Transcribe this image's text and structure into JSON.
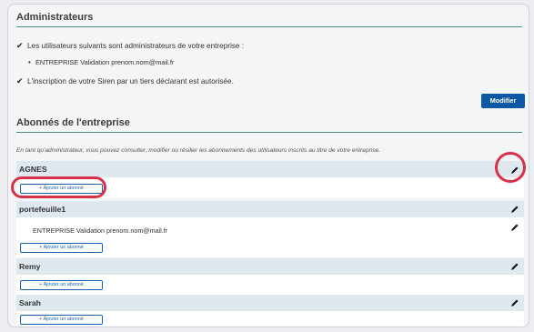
{
  "admin": {
    "title": "Administrateurs",
    "intro": "Les utilisateurs suivants sont administrateurs de votre entreprise :",
    "admins": [
      "ENTREPRISE Validation prenom.nom@mail.fr"
    ],
    "siren_notice": "L'inscription de votre Siren par un tiers déclarant est autorisée.",
    "modify_label": "Modifier"
  },
  "subscribers": {
    "title": "Abonnés de l'entreprise",
    "info": "En tant qu'administrateur, vous pouvez consulter, modifier ou résilier les abonnements des utilisateurs inscrits au titre de votre entreprise.",
    "add_label": "+ Ajouter un abonné",
    "groups": [
      {
        "name": "AGNES",
        "members": []
      },
      {
        "name": "portefeuille1",
        "members": [
          "ENTREPRISE Validation prenom.nom@mail.fr"
        ]
      },
      {
        "name": "Remy",
        "members": []
      },
      {
        "name": "Sarah",
        "members": []
      }
    ]
  },
  "icons": {
    "check": "check-icon",
    "edit": "pencil-icon"
  },
  "colors": {
    "accent_rule": "#4a8d86",
    "button_blue": "#0b58a4",
    "row_header": "#dfe7ef",
    "highlight": "#d9304a"
  }
}
